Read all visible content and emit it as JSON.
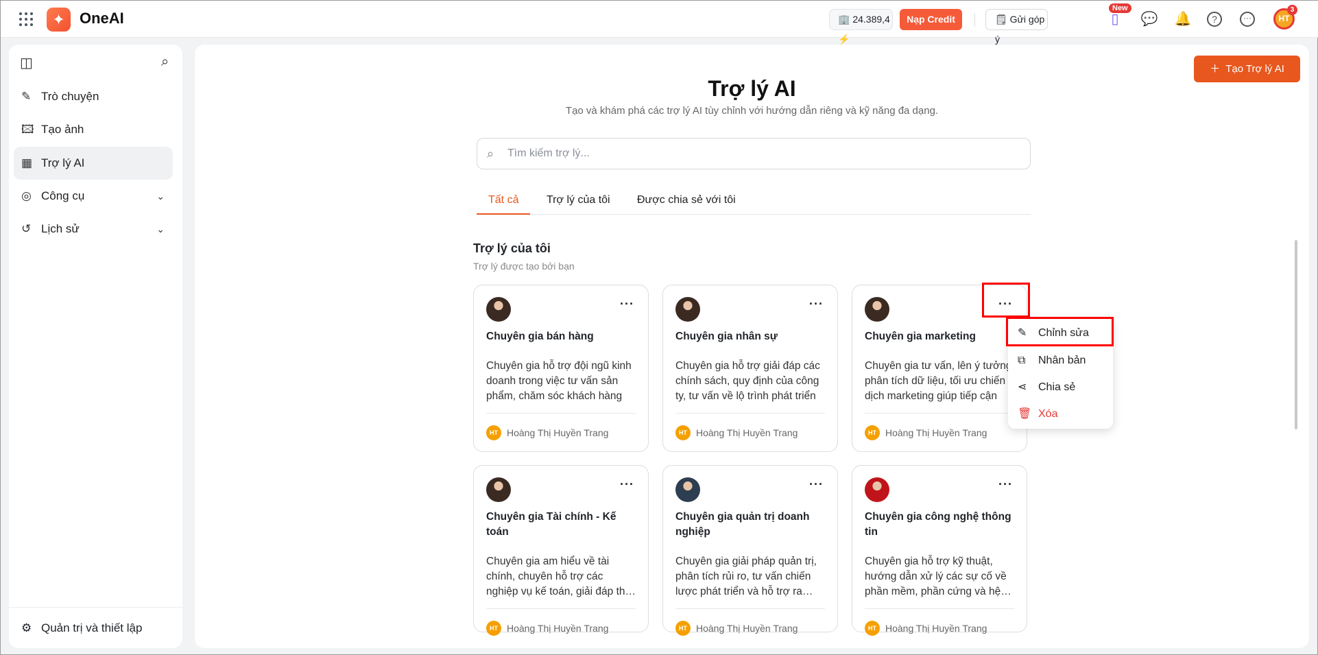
{
  "header": {
    "brand": "OneAI",
    "credit": "24.389,4",
    "topup_label": "Nạp Credit",
    "feedback_label": "Gửi góp ý",
    "new_badge": "New",
    "user_initials": "HT",
    "notification_count": "3"
  },
  "sidebar": {
    "items": [
      {
        "label": "Trò chuyện",
        "icon": "edit-icon"
      },
      {
        "label": "Tạo ảnh",
        "icon": "image-plus-icon"
      },
      {
        "label": "Trợ lý AI",
        "icon": "grid-icon",
        "active": true
      },
      {
        "label": "Công cụ",
        "icon": "compass-icon",
        "expandable": true
      },
      {
        "label": "Lịch sử",
        "icon": "history-icon",
        "expandable": true
      }
    ],
    "footer": "Quản trị và thiết lập"
  },
  "main": {
    "create_label": "Tạo Trợ lý AI",
    "title": "Trợ lý AI",
    "subtitle": "Tạo và khám phá các trợ lý AI tùy chỉnh với hướng dẫn riêng và kỹ năng đa dạng.",
    "search_placeholder": "Tìm kiếm trợ lý...",
    "tabs": [
      {
        "label": "Tất cả",
        "active": true
      },
      {
        "label": "Trợ lý của tôi"
      },
      {
        "label": "Được chia sẻ với tôi"
      }
    ],
    "section_title": "Trợ lý của tôi",
    "section_subtitle": "Trợ lý được tạo bởi bạn",
    "cards": [
      {
        "title": "Chuyên gia bán hàng",
        "desc": "Chuyên gia hỗ trợ đội ngũ kinh doanh trong việc tư vấn sản phẩm, chăm sóc khách hàng",
        "author": "Hoàng Thị Huyền Trang",
        "author_initials": "HT"
      },
      {
        "title": "Chuyên gia nhân sự",
        "desc": "Chuyên gia hỗ trợ giải đáp các chính sách, quy định của công ty, tư vấn về lộ trình phát triển",
        "author": "Hoàng Thị Huyền Trang",
        "author_initials": "HT"
      },
      {
        "title": "Chuyên gia marketing",
        "desc": "Chuyên gia tư vấn, lên ý tưởng, phân tích dữ liệu, tối ưu chiến dịch marketing giúp tiếp cận",
        "author": "Hoàng Thị Huyền Trang",
        "author_initials": "HT"
      },
      {
        "title": "Chuyên gia Tài chính - Kế toán",
        "desc": "Chuyên gia am hiểu về tài chính, chuyên hỗ trợ các nghiệp vụ kế toán, giải đáp thắc mắc",
        "author": "Hoàng Thị Huyền Trang",
        "author_initials": "HT"
      },
      {
        "title": "Chuyên gia quản trị doanh nghiệp",
        "desc": "Chuyên gia giải pháp quản trị, phân tích rủi ro, tư vấn chiến lược phát triển và hỗ trợ ra quyết định",
        "author": "Hoàng Thị Huyền Trang",
        "author_initials": "HT"
      },
      {
        "title": "Chuyên gia công nghệ thông tin",
        "desc": "Chuyên gia hỗ trợ kỹ thuật, hướng dẫn xử lý các sự cố về phần mềm, phần cứng và hệ thống",
        "author": "Hoàng Thị Huyền Trang",
        "author_initials": "HT"
      }
    ],
    "context_menu": {
      "edit": "Chỉnh sửa",
      "duplicate": "Nhân bản",
      "share": "Chia sẻ",
      "delete": "Xóa"
    }
  },
  "colors": {
    "accent": "#e8571e",
    "danger": "#e53935"
  }
}
